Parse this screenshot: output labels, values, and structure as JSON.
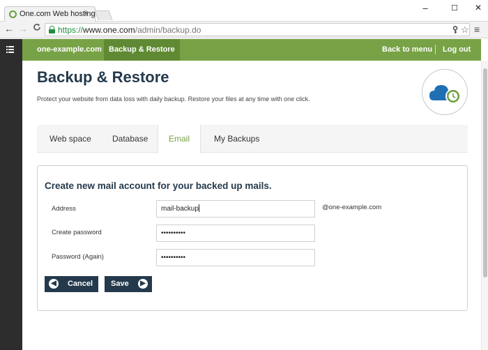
{
  "browser": {
    "tab_title": "One.com Web hosting  -",
    "tab_close": "×",
    "window_controls": {
      "minimize": "–",
      "maximize": "☐",
      "close": "✕"
    },
    "nav": {
      "back": "←",
      "forward": "→",
      "reload": "C"
    },
    "url_scheme": "https://",
    "url_host": "www.one.com",
    "url_path": "/admin/backup.do",
    "icons": [
      "lock-icon",
      "key-icon",
      "star-icon",
      "menu-icon"
    ]
  },
  "topbar": {
    "site_name": "one-example.com",
    "active_section": "Backup & Restore",
    "back_link": "Back to menu",
    "logout": "Log out"
  },
  "page": {
    "title": "Backup & Restore",
    "description": "Protect your website from data loss with daily backup. Restore your files at any time with one click."
  },
  "tabs": [
    {
      "label": "Web space",
      "active": false
    },
    {
      "label": "Database",
      "active": false
    },
    {
      "label": "Email",
      "active": true
    },
    {
      "label": "My Backups",
      "active": false
    }
  ],
  "form": {
    "title": "Create new mail account for your backed up mails.",
    "address_label": "Address",
    "address_value": "mail-backup",
    "address_suffix": "@one-example.com",
    "password_label": "Create password",
    "password_value": "••••••••••",
    "password_again_label": "Password (Again)",
    "password_again_value": "••••••••••",
    "cancel_label": "Cancel",
    "save_label": "Save"
  },
  "colors": {
    "brand_green": "#77a246",
    "brand_green_dark": "#5f8a33",
    "navy": "#24394c",
    "cloud_blue": "#1f6fb5",
    "clock_green": "#6a9e3c"
  }
}
